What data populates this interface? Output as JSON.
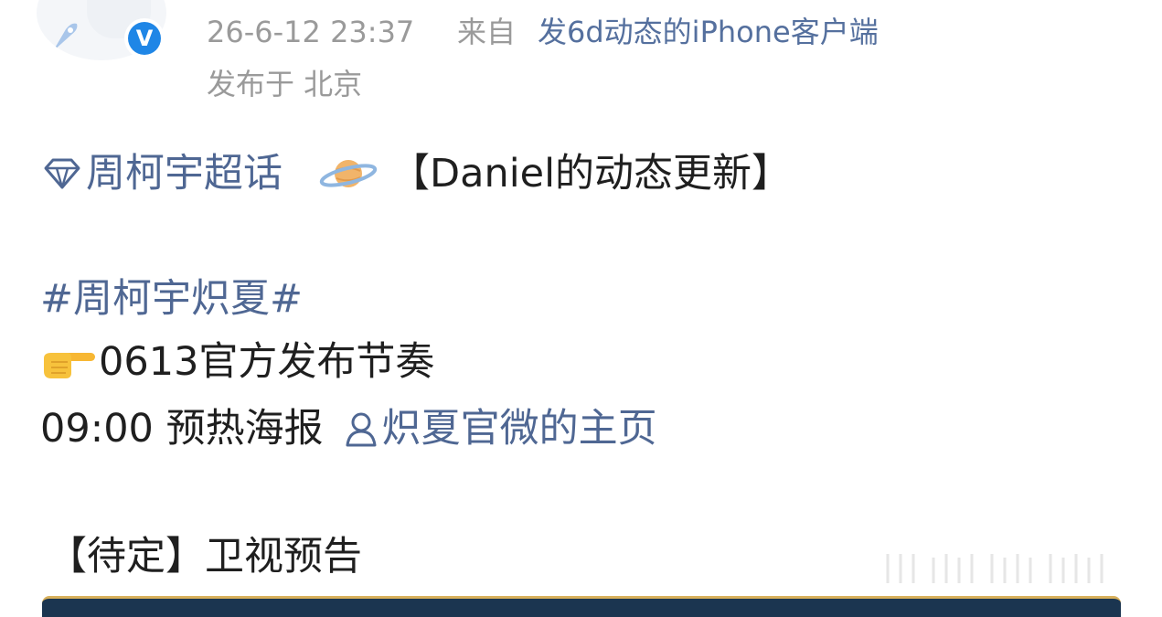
{
  "header": {
    "timestamp": "26-6-12 23:37",
    "from_label": "来自",
    "source": "发6d动态的iPhone客户端",
    "location": "发布于 北京"
  },
  "icons": {
    "verified": "verified-v-badge",
    "supertopic": "diamond-icon",
    "planet": "planet-emoji",
    "hand": "pointing-hand-emoji",
    "user": "person-icon"
  },
  "verified_letter": "V",
  "post": {
    "supertopic_label": "周柯宇超话",
    "heading": "【Daniel的动态更新】",
    "hashtag": "#周柯宇炽夏#",
    "rhythm_line": "0613官方发布节奏",
    "schedule_time": "09:00 预热海报",
    "mention_label": "炽夏官微的主页",
    "tbd_line": "【待定】卫视预告"
  },
  "colors": {
    "link": "#4f6793",
    "meta": "#9a9a9a",
    "verified": "#1f86e6",
    "text": "#1f1f1f"
  }
}
